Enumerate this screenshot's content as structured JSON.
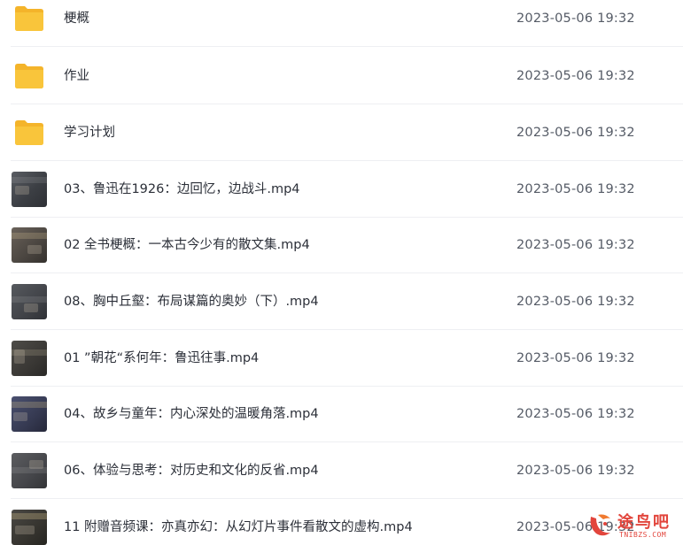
{
  "files": [
    {
      "type": "folder",
      "name": "梗概",
      "modified": "2023-05-06 19:32"
    },
    {
      "type": "folder",
      "name": "作业",
      "modified": "2023-05-06 19:32"
    },
    {
      "type": "folder",
      "name": "学习计划",
      "modified": "2023-05-06 19:32"
    },
    {
      "type": "video",
      "name": "03、鲁迅在1926：边回忆，边战斗.mp4",
      "modified": "2023-05-06 19:32"
    },
    {
      "type": "video",
      "name": "02 全书梗概：一本古今少有的散文集.mp4",
      "modified": "2023-05-06 19:32"
    },
    {
      "type": "video",
      "name": "08、胸中丘壑：布局谋篇的奥妙（下）.mp4",
      "modified": "2023-05-06 19:32"
    },
    {
      "type": "video",
      "name": "01 ”朝花“系何年：鲁迅往事.mp4",
      "modified": "2023-05-06 19:32"
    },
    {
      "type": "video",
      "name": "04、故乡与童年：内心深处的温暖角落.mp4",
      "modified": "2023-05-06 19:32"
    },
    {
      "type": "video",
      "name": "06、体验与思考：对历史和文化的反省.mp4",
      "modified": "2023-05-06 19:32"
    },
    {
      "type": "video",
      "name": "11 附赠音频课：亦真亦幻：从幻灯片事件看散文的虚构.mp4",
      "modified": "2023-05-06 19:32"
    }
  ],
  "watermark": {
    "text": "途鸟吧",
    "url": "TNIBZS.COM"
  },
  "colors": {
    "folder": "#f9c53b",
    "folder_tab": "#f4b42a",
    "divider": "#eeeff2",
    "watermark": "#e2453c"
  }
}
